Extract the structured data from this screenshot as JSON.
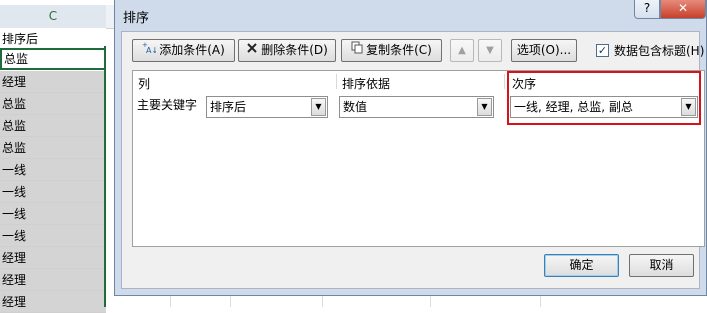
{
  "sheet": {
    "column_label": "C",
    "header_cell": "排序后",
    "rows": [
      "总监",
      "总监",
      "总监",
      "总监",
      "一线",
      "一线",
      "一线",
      "一线",
      "经理",
      "经理",
      "经理",
      "经理"
    ]
  },
  "dialog": {
    "title": "排序",
    "help_label": "?",
    "close_label": "✕",
    "toolbar": {
      "add_label": "添加条件(A)",
      "delete_label": "删除条件(D)",
      "copy_label": "复制条件(C)",
      "up_label": "▲",
      "down_label": "▼",
      "options_label": "选项(O)...",
      "has_header_label": "数据包含标题(H)",
      "has_header_checked": true,
      "check_mark": "✓"
    },
    "columns": {
      "column": "列",
      "sort_on": "排序依据",
      "order": "次序"
    },
    "level": {
      "label": "主要关键字",
      "column_value": "排序后",
      "sort_on_value": "数值",
      "order_value": "一线, 经理, 总监, 副总"
    },
    "ok_label": "确定",
    "cancel_label": "取消"
  },
  "colors": {
    "highlight": "#d6131b",
    "selection_border": "#1e6b3b",
    "dialog_frame": "#cfdbea"
  }
}
